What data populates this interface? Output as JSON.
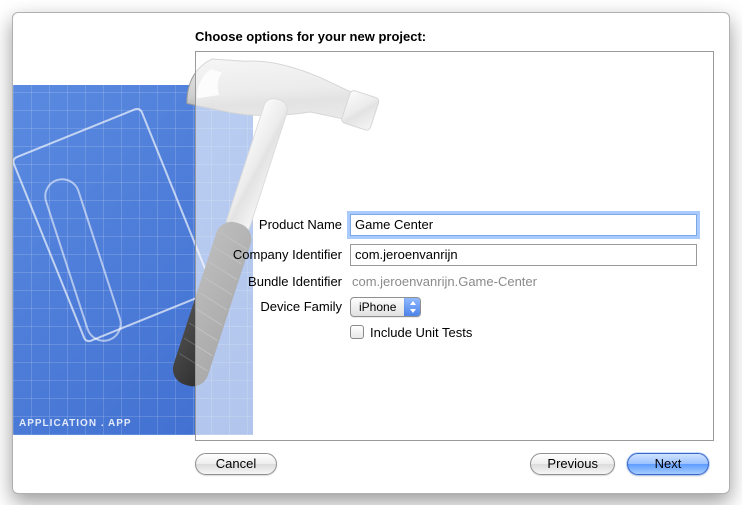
{
  "title": "Choose options for your new project:",
  "blueprint_caption": "APPLICATION . APP",
  "form": {
    "product_name": {
      "label": "Product Name",
      "value": "Game Center"
    },
    "company_identifier": {
      "label": "Company Identifier",
      "value": "com.jeroenvanrijn"
    },
    "bundle_identifier": {
      "label": "Bundle Identifier",
      "value": "com.jeroenvanrijn.Game-Center"
    },
    "device_family": {
      "label": "Device Family",
      "value": "iPhone"
    },
    "include_unit_tests": {
      "label": "Include Unit Tests",
      "checked": false
    }
  },
  "buttons": {
    "cancel": "Cancel",
    "previous": "Previous",
    "next": "Next"
  }
}
